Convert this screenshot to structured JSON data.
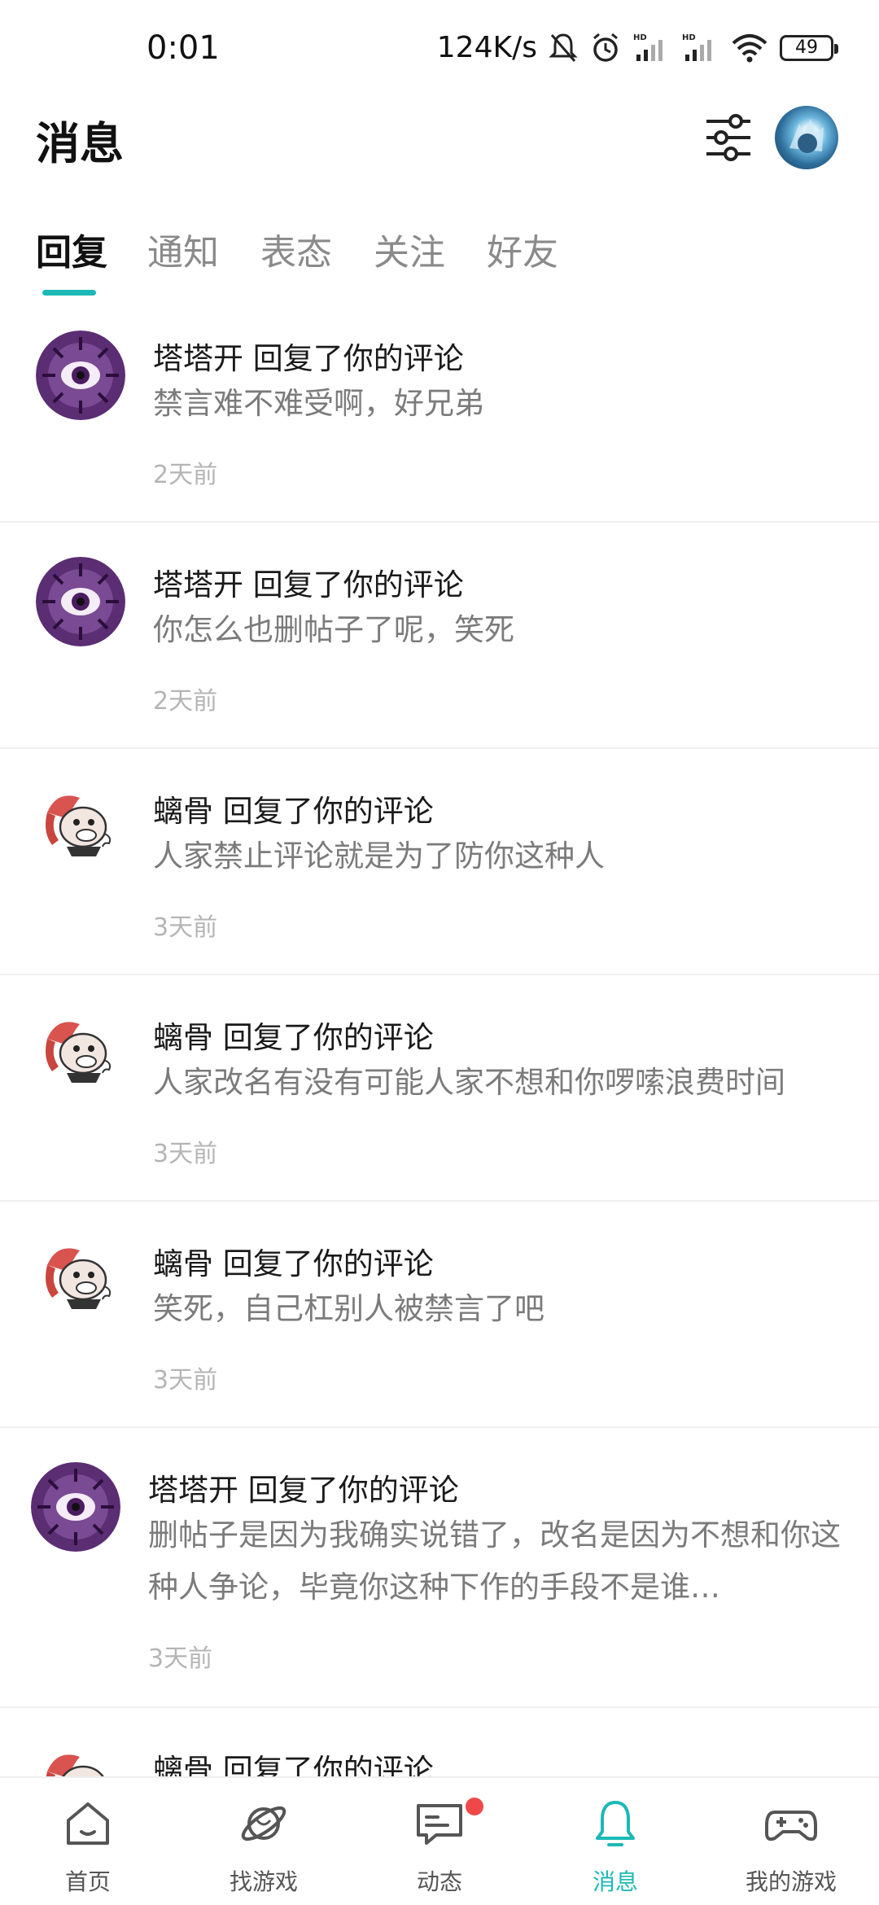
{
  "status_bar": {
    "time": "0:01",
    "speed": "124K/s",
    "battery": "49",
    "icons": [
      "bell-muted-icon",
      "alarm-icon",
      "signal-hd-icon",
      "signal-hd-icon",
      "wifi-icon",
      "battery-icon"
    ]
  },
  "header": {
    "title": "消息"
  },
  "tabs": [
    {
      "label": "回复",
      "active": true
    },
    {
      "label": "通知",
      "active": false
    },
    {
      "label": "表态",
      "active": false
    },
    {
      "label": "关注",
      "active": false
    },
    {
      "label": "好友",
      "active": false
    }
  ],
  "messages": [
    {
      "avatar": "purple-eye-avatar",
      "title": "塔塔开 回复了你的评论",
      "content": "禁言难不难受啊，好兄弟",
      "time": "2天前"
    },
    {
      "avatar": "purple-eye-avatar",
      "title": "塔塔开 回复了你的评论",
      "content": "你怎么也删帖子了呢，笑死",
      "time": "2天前"
    },
    {
      "avatar": "cartoon-ram-avatar",
      "title": "螭骨 回复了你的评论",
      "content": "人家禁止评论就是为了防你这种人",
      "time": "3天前"
    },
    {
      "avatar": "cartoon-ram-avatar",
      "title": "螭骨 回复了你的评论",
      "content": "人家改名有没有可能人家不想和你啰嗦浪费时间",
      "time": "3天前"
    },
    {
      "avatar": "cartoon-ram-avatar",
      "title": "螭骨 回复了你的评论",
      "content": "笑死，自己杠别人被禁言了吧",
      "time": "3天前"
    },
    {
      "avatar": "purple-eye-avatar",
      "title": "塔塔开 回复了你的评论",
      "content": "删帖子是因为我确实说错了，改名是因为不想和你这种人争论，毕竟你这种下作的手段不是谁…",
      "time": "3天前"
    },
    {
      "avatar": "cartoon-ram-avatar",
      "title": "螭骨 回复了你的评论",
      "content": "",
      "time": ""
    }
  ],
  "bottom_nav": [
    {
      "label": "首页",
      "icon": "home-icon"
    },
    {
      "label": "找游戏",
      "icon": "planet-icon"
    },
    {
      "label": "动态",
      "icon": "chat-bubble-icon",
      "badge": true
    },
    {
      "label": "消息",
      "icon": "bell-icon",
      "active": true
    },
    {
      "label": "我的游戏",
      "icon": "gamepad-icon"
    }
  ],
  "colors": {
    "accent": "#1cb9b6",
    "badge": "#f04848",
    "secondary_text": "#7b7b7b",
    "time_text": "#b5b5b5"
  }
}
